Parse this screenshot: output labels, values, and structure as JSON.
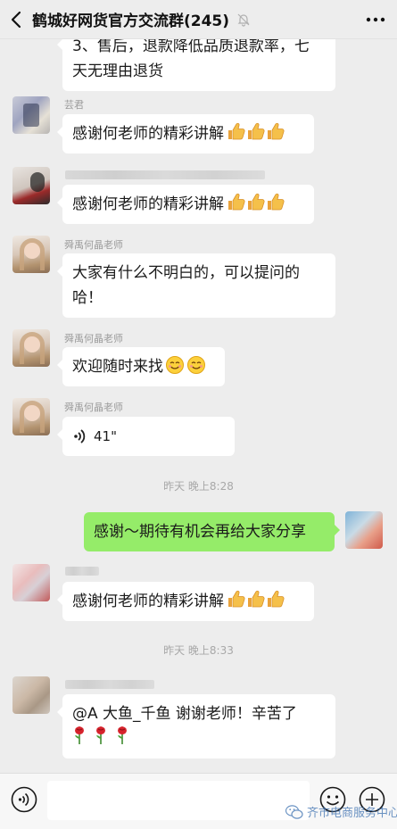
{
  "header": {
    "title": "鹤城好网货官方交流群(245)",
    "back_icon": "chevron-left-icon",
    "mute_icon": "bell-off-icon",
    "more_icon": "more-dots-icon"
  },
  "messages": {
    "m0_line1": "3、售后，退款降低品质退款率，七",
    "m0_line2": "天无理由退货",
    "m1_sender": "芸君",
    "m1_text": "感谢何老师的精彩讲解",
    "m2_text": "感谢何老师的精彩讲解",
    "m3_sender": "舜禹何晶老师",
    "m3_line1": "大家有什么不明白的，可以提问的",
    "m3_line2": "哈！",
    "m4_sender": "舜禹何晶老师",
    "m4_text": "欢迎随时来找",
    "m5_sender": "舜禹何晶老师",
    "m5_voice_duration": "41\"",
    "time1": "昨天 晚上8:28",
    "m6_text": "感谢～期待有机会再给大家分享",
    "m7_text": "感谢何老师的精彩讲解",
    "time2": "昨天 晚上8:33",
    "m8_text": "@A 大鱼_千鱼  谢谢老师！辛苦了"
  },
  "input": {
    "voice_icon": "voice-icon",
    "emoji_icon": "smiley-icon",
    "plus_icon": "plus-circle-icon"
  },
  "watermark": {
    "text": "齐市电商服务中心",
    "icon": "wechat-logo-icon"
  },
  "colors": {
    "background": "#ededed",
    "bubble_self": "#95ec69",
    "bubble_other": "#ffffff"
  }
}
